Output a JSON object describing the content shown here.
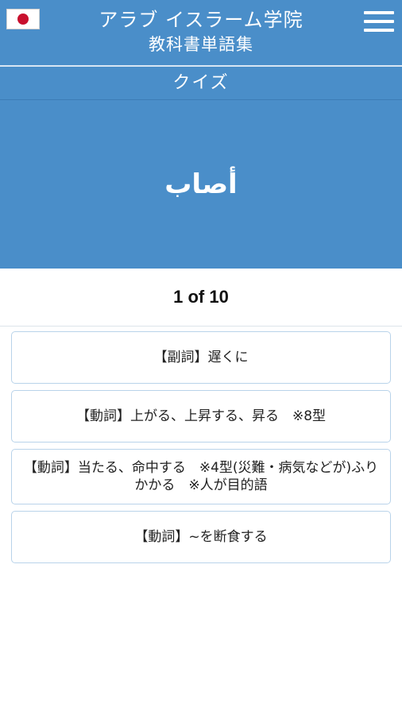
{
  "header": {
    "title_line1": "アラブ イスラーム学院",
    "title_line2": "教科書単語集",
    "flag_icon": "japan-flag-icon",
    "menu_icon": "hamburger-menu-icon"
  },
  "quiz": {
    "label": "クイズ",
    "word": "أصاب",
    "progress": "1 of 10"
  },
  "answers": [
    "【副詞】遅くに",
    "【動詞】上がる、上昇する、昇る　※8型",
    "【動詞】当たる、命中する　※4型(災難・病気などが)ふりかかる　※人が目的語",
    "【動詞】~を断食する"
  ],
  "colors": {
    "primary": "#4a8ec9",
    "flag_red": "#c8102e",
    "answer_border": "#b9d3ea"
  }
}
